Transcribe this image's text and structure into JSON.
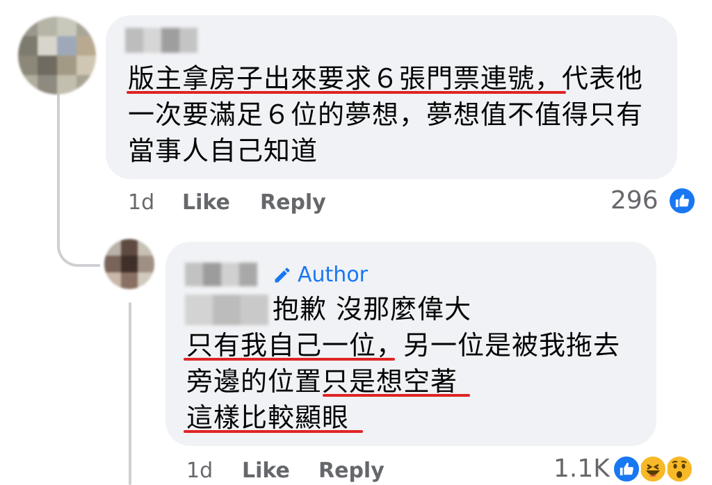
{
  "colors": {
    "bubble": "#f0f2f5",
    "underline": "#e02424",
    "meta_text": "#65676b",
    "like_blue": "#1877f2",
    "haha_yellow": "#f7b928"
  },
  "comment1": {
    "lines": [
      "版主拿房子出來要求６張門票連號，代表他",
      "一次要滿足６位的夢想，夢想值不值得只有",
      "當事人自己知道"
    ],
    "time": "1d",
    "like_label": "Like",
    "reply_label": "Reply",
    "reaction_count": "296",
    "reaction_icons": [
      "like-icon"
    ]
  },
  "comment2": {
    "author_badge": "Author",
    "author_icon": "pencil-icon",
    "lines": [
      "抱歉 沒那麼偉大",
      "只有我自己一位，另一位是被我拖去",
      "旁邊的位置只是想空著",
      "這樣比較顯眼"
    ],
    "time": "1d",
    "like_label": "Like",
    "reply_label": "Reply",
    "reaction_count": "1.1K",
    "reaction_icons": [
      "like-icon",
      "haha-icon",
      "wow-icon"
    ]
  }
}
